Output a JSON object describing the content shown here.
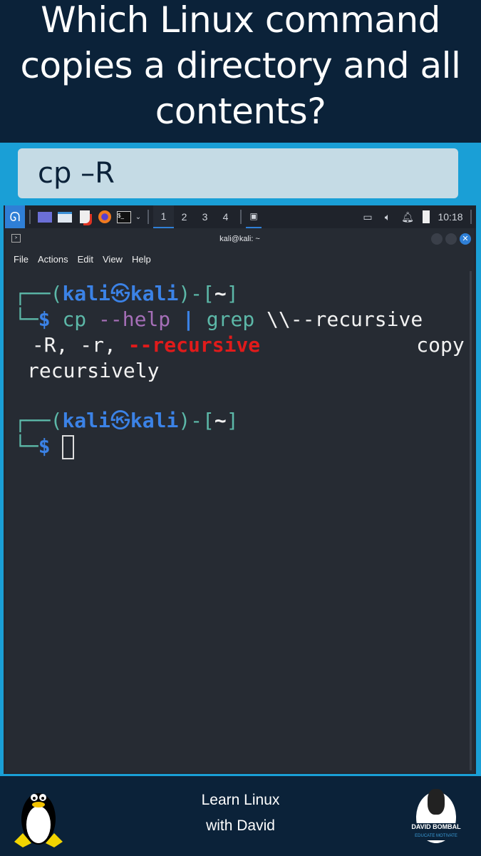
{
  "question": "Which Linux command copies a directory and all contents?",
  "answer": "cp –R",
  "taskbar": {
    "workspaces": [
      "1",
      "2",
      "3",
      "4"
    ],
    "clock": "10:18"
  },
  "terminal": {
    "title": "kali@kali: ~",
    "menu": [
      "File",
      "Actions",
      "Edit",
      "View",
      "Help"
    ],
    "prompt": {
      "open": "┌──(",
      "user": "kali",
      "sym": "㉿",
      "host": "kali",
      "close": ")-[",
      "dir": "~",
      "end": "]",
      "corner": "└─",
      "dollar": "$"
    },
    "cmd": {
      "cp": "cp",
      "help": "--help",
      "pipe": "|",
      "grep": "grep",
      "arg": "\\\\--recursive"
    },
    "output1_a": " -R, -r, ",
    "output1_match": "--recursive",
    "output1_b": "             copy",
    "output2": "recursively"
  },
  "footer": {
    "line1": "Learn Linux",
    "line2": "with David",
    "logo_text": "DAVID BOMBAL",
    "logo_sub": "EDUCATE MOTIVATE"
  },
  "colors": {
    "navy": "#0b2239",
    "border_blue": "#1a9fd6",
    "answer_bg": "#c5dbe5",
    "terminal_bg": "#262b33",
    "match_red": "#e01b1b"
  }
}
